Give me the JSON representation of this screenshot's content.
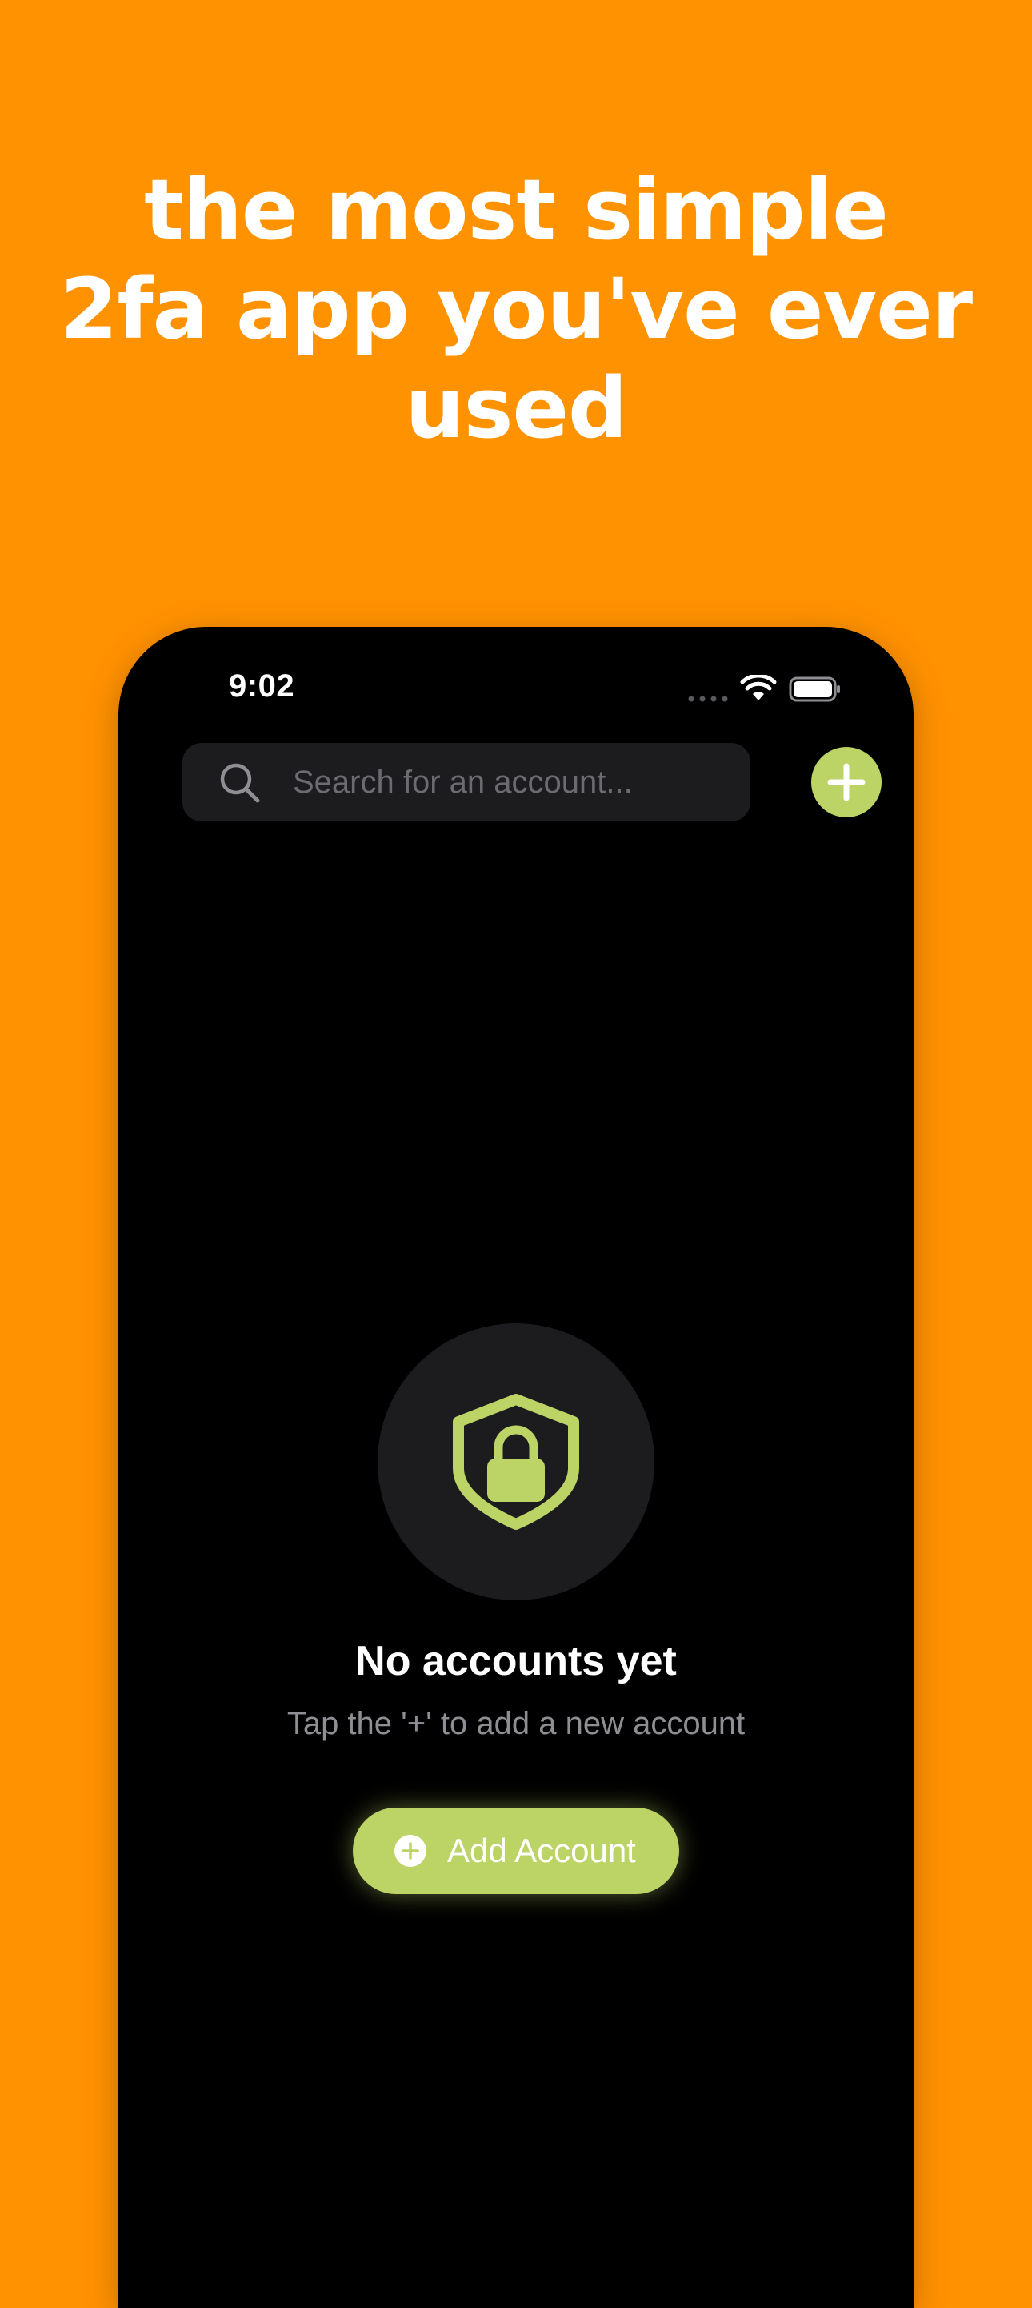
{
  "headline": {
    "lines": [
      "the most simple",
      "2fa app you've ever",
      "used"
    ]
  },
  "status_bar": {
    "time": "9:02"
  },
  "search": {
    "placeholder": "Search for an account..."
  },
  "empty_state": {
    "title": "No accounts yet",
    "subtitle": "Tap the '+' to add a new account",
    "button_label": "Add Account"
  },
  "icons": {
    "search": "search-icon",
    "add": "plus-icon",
    "shield": "shield-lock-icon",
    "wifi": "wifi-icon",
    "battery": "battery-icon",
    "signal": "signal-icon"
  },
  "colors": {
    "background": "#FF9200",
    "accent": "#BCD365",
    "surface": "#1c1c1e",
    "phone": "#000000"
  }
}
